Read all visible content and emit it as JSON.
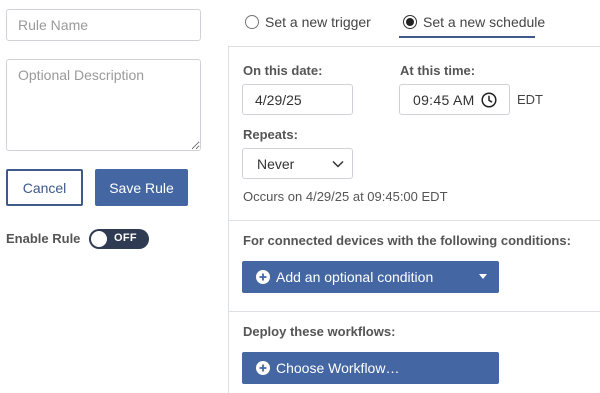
{
  "left": {
    "rule_name_placeholder": "Rule Name",
    "description_placeholder": "Optional Description",
    "cancel_label": "Cancel",
    "save_label": "Save Rule",
    "enable_label": "Enable Rule",
    "toggle_state": "OFF"
  },
  "mode": {
    "trigger_label": "Set a new trigger",
    "schedule_label": "Set a new schedule",
    "selected": "schedule"
  },
  "schedule": {
    "date_label": "On this date:",
    "date_value": "4/29/25",
    "time_label": "At this time:",
    "time_value": "09:45 AM",
    "timezone": "EDT",
    "repeats_label": "Repeats:",
    "repeats_value": "Never",
    "occurs_text": "Occurs on 4/29/25 at 09:45:00 EDT"
  },
  "conditions": {
    "heading": "For connected devices with the following conditions:",
    "add_condition_label": "Add an optional condition"
  },
  "workflows": {
    "heading": "Deploy these workflows:",
    "choose_label": "Choose Workflow…"
  },
  "colors": {
    "primary": "#4466a3",
    "outline": "#3d5a8a",
    "toggle_bg": "#2f3b52"
  }
}
